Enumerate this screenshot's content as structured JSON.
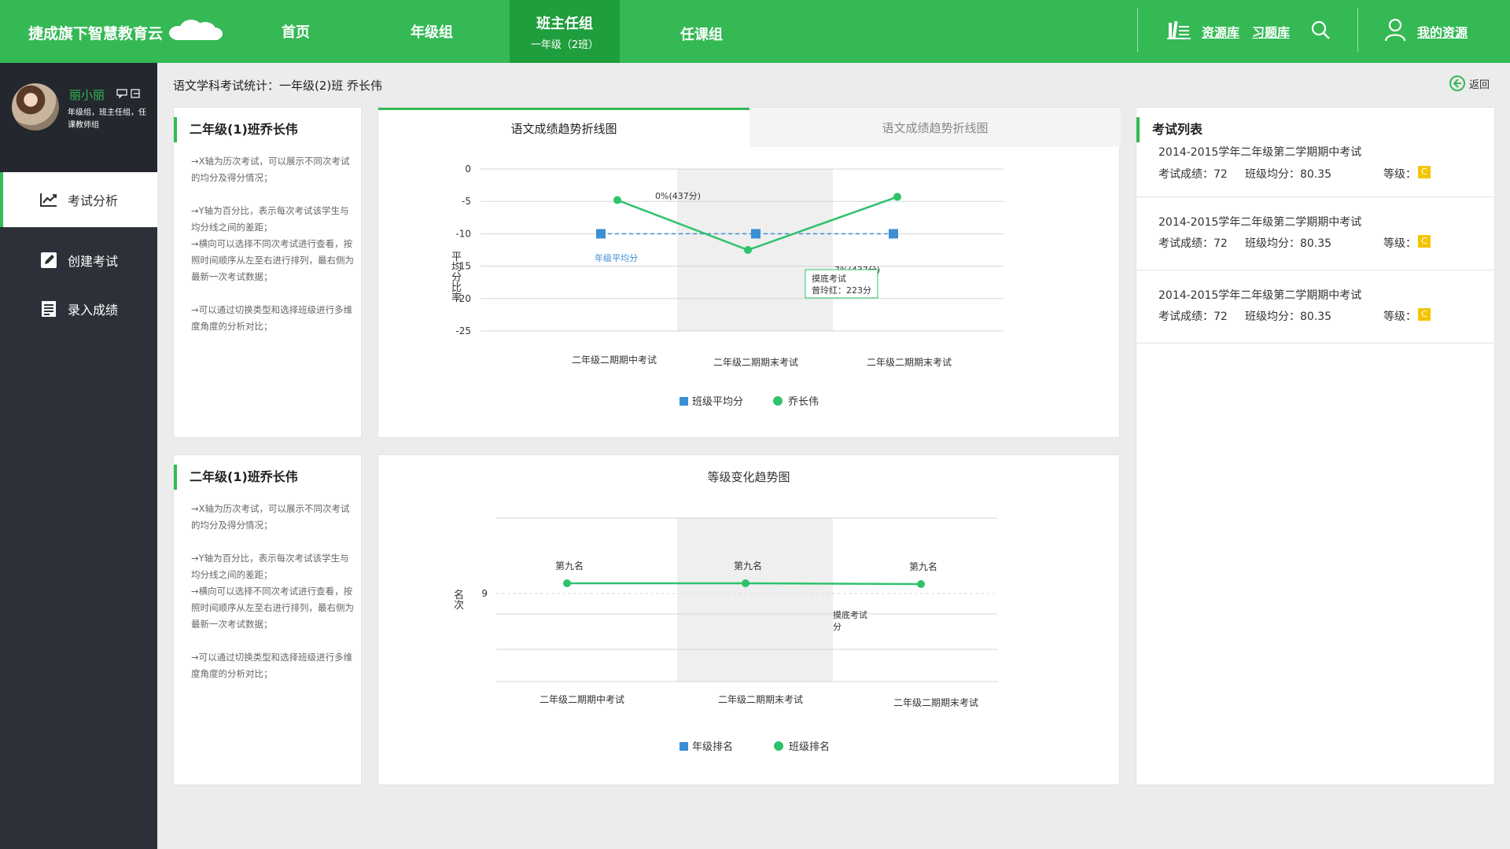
{
  "app": {
    "title": "捷成旗下智慧教育云"
  },
  "nav": {
    "home": "首页",
    "grade_group": "年级组",
    "class_teacher": "班主任组",
    "class_teacher_sub": "一年级（2班）",
    "subject_group": "任课组",
    "resource_lib": "资源库",
    "exercise_lib": "习题库",
    "my_resources": "我的资源"
  },
  "profile": {
    "name": "丽小丽",
    "meta": "年级组，班主任组，任课教师组"
  },
  "sidebar": {
    "items": [
      {
        "label": "考试分析",
        "icon": "chart-line-icon"
      },
      {
        "label": "创建考试",
        "icon": "edit-icon"
      },
      {
        "label": "录入成绩",
        "icon": "list-icon"
      }
    ]
  },
  "breadcrumb": "语文学科考试统计：一年级(2)班  乔长伟",
  "back_label": "返回",
  "info_cards": [
    {
      "title": "二年级(1)班乔长伟",
      "p1": "→X轴为历次考试，可以展示不同次考试的均分及得分情况；",
      "p2": "→Y轴为百分比，表示每次考试该学生与均分线之间的差距；",
      "p3": "→横向可以选择不同次考试进行查看，按照时间顺序从左至右进行排列，最右侧为最新一次考试数据；",
      "p4": "→可以通过切换类型和选择班级进行多维度角度的分析对比；"
    },
    {
      "title": "二年级(1)班乔长伟",
      "p1": "→X轴为历次考试，可以展示不同次考试的均分及得分情况；",
      "p2": "→Y轴为百分比，表示每次考试该学生与均分线之间的差距；",
      "p3": "→横向可以选择不同次考试进行查看，按照时间顺序从左至右进行排列，最右侧为最新一次考试数据；",
      "p4": "→可以通过切换类型和选择班级进行多维度角度的分析对比；"
    }
  ],
  "tabs": [
    "语文成绩趋势折线图",
    "语文成绩趋势折线图"
  ],
  "chart_data": [
    {
      "type": "line",
      "ylabel": "平均分比率",
      "categories": [
        "二年级二期期中考试",
        "二年级二期期末考试",
        "二年级二期期末考试"
      ],
      "yticks": [
        "0",
        "-5",
        "-10",
        "-15",
        "-20",
        "-25"
      ],
      "ylim": [
        -25,
        0
      ],
      "series": [
        {
          "name": "班级平均分",
          "values": [
            -10,
            -10,
            -10
          ],
          "color": "#3b8fd4"
        },
        {
          "name": "乔长伟",
          "values": [
            -4.8,
            -12.5,
            -4.3
          ],
          "color": "#2ec26b"
        }
      ],
      "annotations": {
        "top_label": "0%(437分)",
        "avg_label": "年级平均分",
        "partial_label": "7%(437分)",
        "tooltip_line1": "摸底考试",
        "tooltip_line2": "曾玲红：223分"
      },
      "legend": [
        "班级平均分",
        "乔长伟"
      ]
    },
    {
      "type": "line",
      "title": "等级变化趋势图",
      "ylabel": "名次",
      "categories": [
        "二年级二期期中考试",
        "二年级二期期末考试",
        "二年级二期期末考试"
      ],
      "yticks": [
        "9"
      ],
      "series": [
        {
          "name": "班级排名",
          "values": [
            9,
            9,
            9
          ],
          "color": "#2ec26b",
          "labels": [
            "第九名",
            "第九名",
            "第九名"
          ]
        }
      ],
      "annotations": {
        "tooltip_line1": "摸底考试",
        "tooltip_line2": "分"
      },
      "legend": [
        "年级排名",
        "班级排名"
      ]
    }
  ],
  "exam_list": {
    "title": "考试列表",
    "items": [
      {
        "name": "2014-2015学年二年级第二学期期中考试",
        "score": "考试成绩：72",
        "avg": "班级均分：80.35",
        "grade_label": "等级：",
        "grade": "C"
      },
      {
        "name": "2014-2015学年二年级第二学期期中考试",
        "score": "考试成绩：72",
        "avg": "班级均分：80.35",
        "grade_label": "等级：",
        "grade": "C"
      },
      {
        "name": "2014-2015学年二年级第二学期期中考试",
        "score": "考试成绩：72",
        "avg": "班级均分：80.35",
        "grade_label": "等级：",
        "grade": "C"
      }
    ]
  },
  "colors": {
    "brand": "#34b955",
    "brand_dark": "#1f9e3e",
    "sidebar": "#2d3038",
    "badge": "#f5c400"
  }
}
